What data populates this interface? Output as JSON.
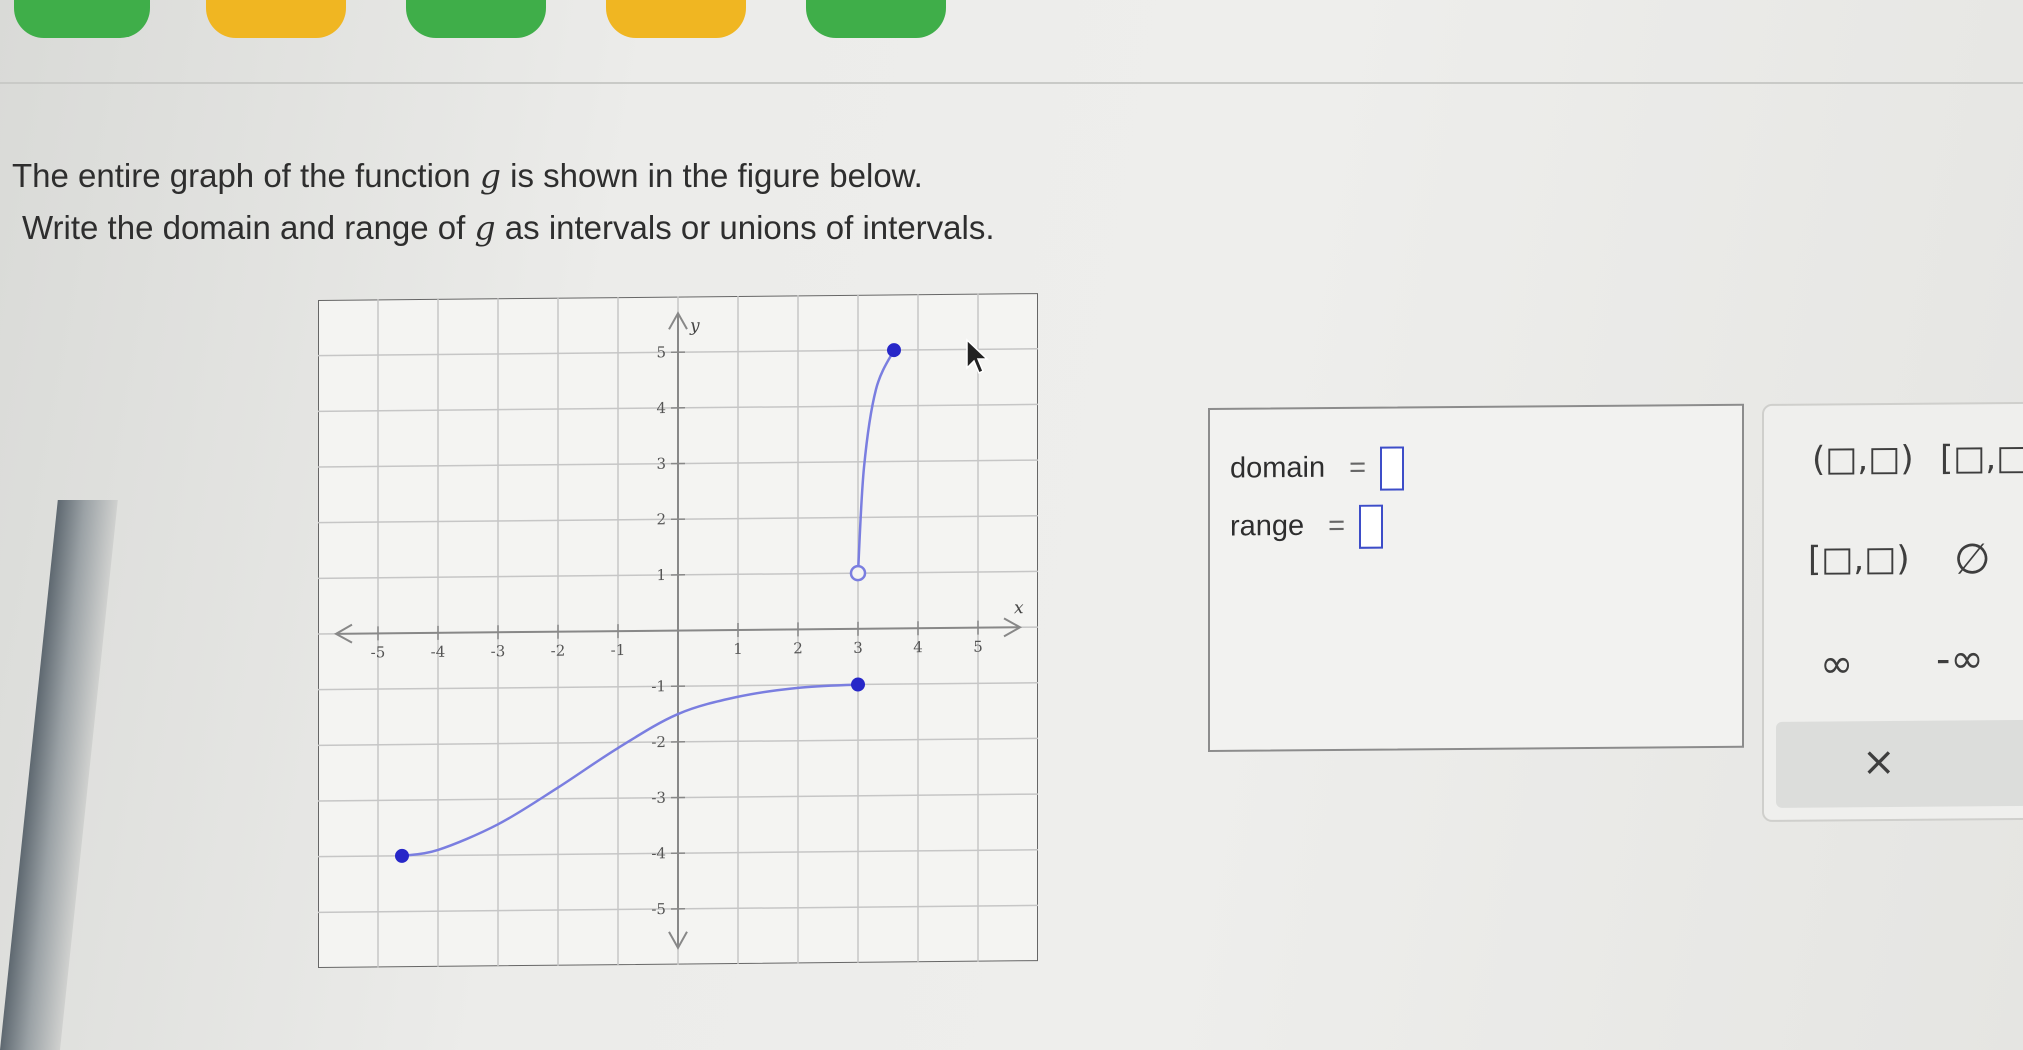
{
  "question": {
    "line1_before": "The entire graph of the function ",
    "line1_var": "g",
    "line1_after": " is shown in the figure below.",
    "line2_before": "Write the domain and range of ",
    "line2_var": "g",
    "line2_after": " as intervals or unions of intervals."
  },
  "answer": {
    "domain_label": "domain",
    "range_label": "range",
    "equals": "=",
    "domain_value": "",
    "range_value": ""
  },
  "keypad": {
    "open_open": "(□,□)",
    "closed_closed": "[□,□]",
    "closed_open": "[□,□)",
    "empty_set": "∅",
    "infinity": "∞",
    "neg_infinity": "-∞",
    "clear": "×"
  },
  "colors": {
    "curve": "#7a7ee0",
    "point": "#2727c8",
    "answer_box": "#3d4dc8",
    "grid": "#c6c6c6",
    "axis": "#888888"
  },
  "chart_data": {
    "type": "line",
    "xlabel": "x",
    "ylabel": "y",
    "xlim": [
      -6,
      6
    ],
    "ylim": [
      -6,
      6
    ],
    "grid": true,
    "x_ticks": [
      -5,
      -4,
      -3,
      -2,
      -1,
      1,
      2,
      3,
      4,
      5
    ],
    "y_ticks": [
      5,
      4,
      3,
      2,
      1,
      -1,
      -2,
      -3,
      -4,
      -5
    ],
    "series": [
      {
        "points": [
          [
            -4.6,
            -4.0
          ],
          [
            -4.0,
            -3.9
          ],
          [
            -3.0,
            -3.45
          ],
          [
            -2.0,
            -2.8
          ],
          [
            -1.0,
            -2.1
          ],
          [
            0.0,
            -1.5
          ],
          [
            1.0,
            -1.2
          ],
          [
            2.0,
            -1.05
          ],
          [
            3.0,
            -1.0
          ]
        ],
        "start_point": {
          "x": -4.6,
          "y": -4.0,
          "closed": true
        },
        "end_point": {
          "x": 3.0,
          "y": -1.0,
          "closed": true
        }
      },
      {
        "points": [
          [
            3.0,
            1.0
          ],
          [
            3.1,
            2.9
          ],
          [
            3.3,
            4.3
          ],
          [
            3.6,
            5.0
          ]
        ],
        "start_point": {
          "x": 3.0,
          "y": 1.0,
          "closed": false
        },
        "end_point": {
          "x": 3.6,
          "y": 5.0,
          "closed": true
        }
      }
    ]
  }
}
